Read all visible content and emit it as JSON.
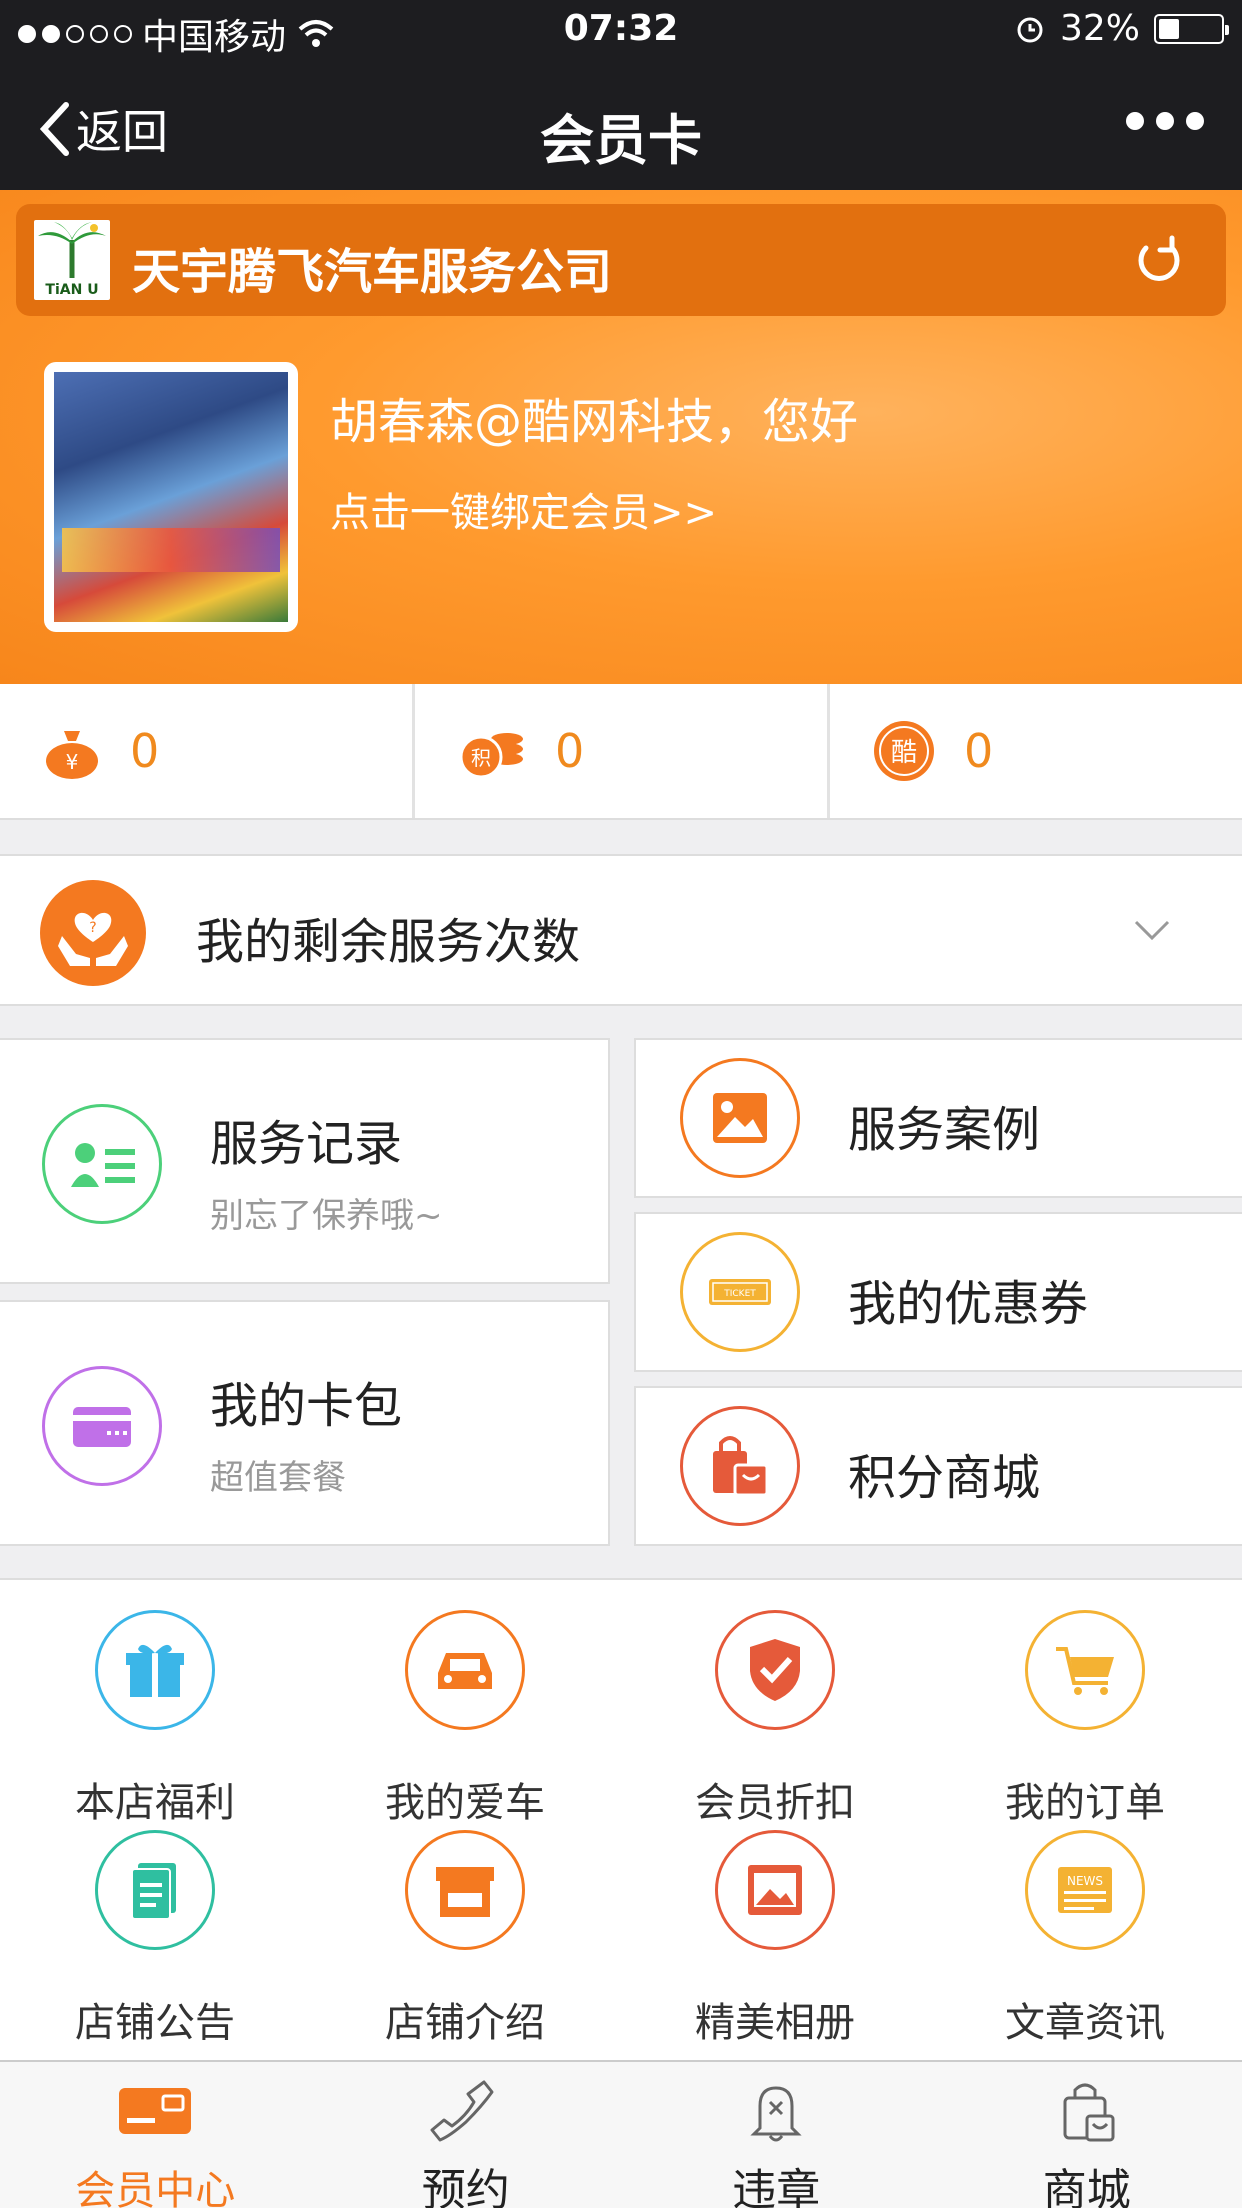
{
  "status": {
    "carrier": "中国移动",
    "time": "07:32",
    "battery": "32%"
  },
  "nav": {
    "back_label": "返回",
    "title": "会员卡"
  },
  "company": {
    "name": "天宇腾飞汽车服务公司",
    "logo_text": "TiAN U"
  },
  "member": {
    "greeting": "胡春森@酷网科技，您好",
    "bind_link": "点击一键绑定会员>>"
  },
  "stats": [
    {
      "icon": "money-bag-icon",
      "value": "0"
    },
    {
      "icon": "points-coins-icon",
      "value": "0"
    },
    {
      "icon": "cool-coin-icon",
      "value": "0"
    }
  ],
  "remaining": {
    "label": "我的剩余服务次数"
  },
  "cards": {
    "service_record": {
      "title": "服务记录",
      "subtitle": "别忘了保养哦~"
    },
    "card_wallet": {
      "title": "我的卡包",
      "subtitle": "超值套餐"
    },
    "service_cases": {
      "title": "服务案例"
    },
    "coupons": {
      "title": "我的优惠券"
    },
    "points_mall": {
      "title": "积分商城"
    }
  },
  "grid": [
    {
      "label": "本店福利",
      "icon": "gift-icon",
      "color": "#3bb6e8"
    },
    {
      "label": "我的爱车",
      "icon": "car-icon",
      "color": "#f47920"
    },
    {
      "label": "会员折扣",
      "icon": "shield-check-icon",
      "color": "#e55a3a"
    },
    {
      "label": "我的订单",
      "icon": "cart-icon",
      "color": "#f4b233"
    },
    {
      "label": "店铺公告",
      "icon": "document-icon",
      "color": "#2fbfa0"
    },
    {
      "label": "店铺介绍",
      "icon": "store-icon",
      "color": "#f47920"
    },
    {
      "label": "精美相册",
      "icon": "photo-album-icon",
      "color": "#e55a3a"
    },
    {
      "label": "文章资讯",
      "icon": "news-icon",
      "color": "#f4b233"
    }
  ],
  "tabs": [
    {
      "label": "会员中心",
      "icon": "member-card-icon",
      "active": true
    },
    {
      "label": "预约",
      "icon": "phone-icon",
      "active": false
    },
    {
      "label": "违章",
      "icon": "bell-icon",
      "active": false
    },
    {
      "label": "商城",
      "icon": "shopping-bag-icon",
      "active": false
    }
  ],
  "colors": {
    "accent": "#f47920",
    "nav_bg": "#1d1d20",
    "hero": "#ff9a2e"
  }
}
